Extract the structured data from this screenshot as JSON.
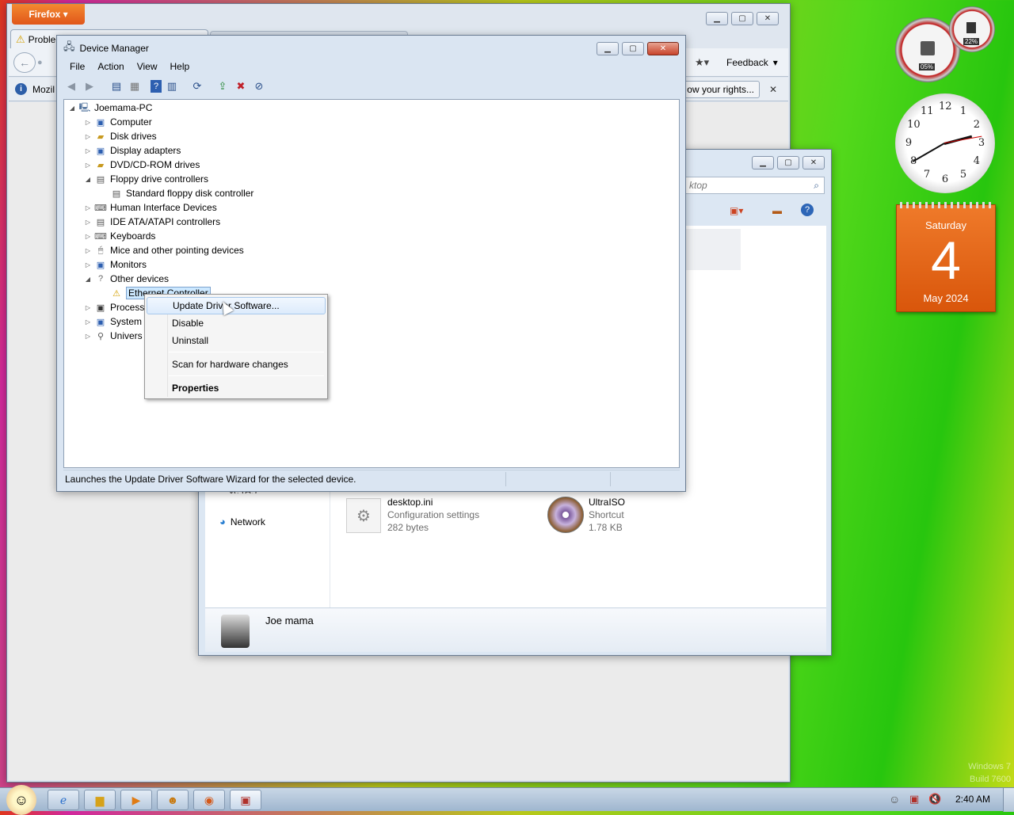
{
  "firefox": {
    "menu_label": "Firefox",
    "tab_title": "Proble",
    "bookmark_label": "Mozil",
    "feedback_label": "Feedback",
    "notification_text": "ow your rights..."
  },
  "device_manager": {
    "title": "Device Manager",
    "menu": [
      "File",
      "Action",
      "View",
      "Help"
    ],
    "tree": {
      "root": "Joemama-PC",
      "items": [
        {
          "label": "Computer",
          "expanded": false
        },
        {
          "label": "Disk drives",
          "expanded": false
        },
        {
          "label": "Display adapters",
          "expanded": false
        },
        {
          "label": "DVD/CD-ROM drives",
          "expanded": false
        },
        {
          "label": "Floppy drive controllers",
          "expanded": true
        },
        {
          "label": "Standard floppy disk controller",
          "child": true
        },
        {
          "label": "Human Interface Devices",
          "expanded": false
        },
        {
          "label": "IDE ATA/ATAPI controllers",
          "expanded": false
        },
        {
          "label": "Keyboards",
          "expanded": false
        },
        {
          "label": "Mice and other pointing devices",
          "expanded": false
        },
        {
          "label": "Monitors",
          "expanded": false
        },
        {
          "label": "Other devices",
          "expanded": true
        },
        {
          "label": "Ethernet Controller",
          "child": true,
          "selected": true
        },
        {
          "label": "Process",
          "expanded": false
        },
        {
          "label": "System",
          "expanded": false
        },
        {
          "label": "Univers",
          "expanded": false
        }
      ]
    },
    "status": "Launches the Update Driver Software Wizard for the selected device."
  },
  "context_menu": {
    "items": [
      "Update Driver Software...",
      "Disable",
      "Uninstall",
      "Scan for hardware changes",
      "Properties"
    ]
  },
  "explorer": {
    "search_placeholder": "ktop",
    "nav_truncated": "ve (A:)",
    "nav_network": "Network",
    "files": [
      {
        "name": "desktop.ini",
        "type": "Configuration settings",
        "size": "282 bytes"
      },
      {
        "name": "UltraISO",
        "type": "Shortcut",
        "size": "1.78 KB"
      }
    ],
    "user_name": "Joe mama"
  },
  "gadgets": {
    "cpu_percent": "05%",
    "mem_percent": "22%",
    "calendar_day_name": "Saturday",
    "calendar_day": "4",
    "calendar_month": "May 2024",
    "clock_numbers": [
      "12",
      "1",
      "2",
      "3",
      "4",
      "5",
      "6",
      "7",
      "8",
      "9",
      "10",
      "11"
    ]
  },
  "watermark": {
    "line1": "Windows 7",
    "line2": "Build 7600"
  },
  "taskbar": {
    "time": "2:40 AM"
  },
  "colors": {
    "accent": "#e0561a",
    "selection": "#cce8ff",
    "calendar": "#e8620e"
  }
}
